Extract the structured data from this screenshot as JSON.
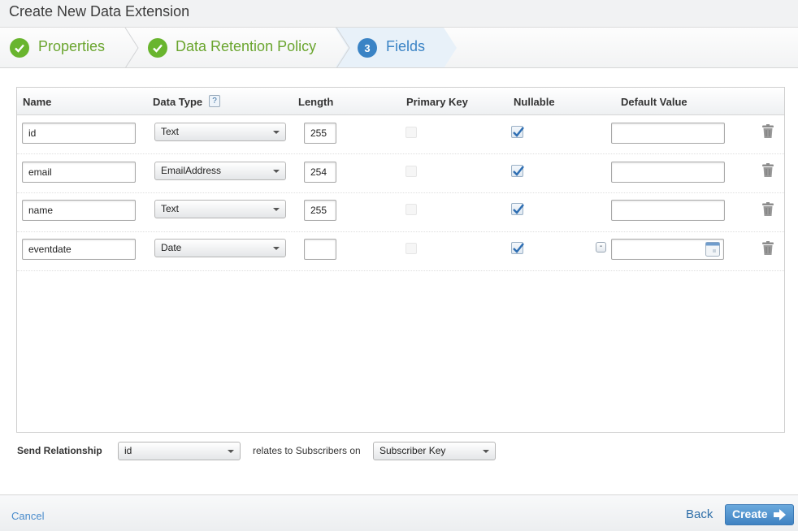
{
  "window": {
    "title": "Create New Data Extension"
  },
  "wizard": {
    "steps": [
      {
        "label": "Properties",
        "state": "complete",
        "icon": "check-circle-icon"
      },
      {
        "label": "Data Retention Policy",
        "state": "complete",
        "icon": "check-circle-icon"
      },
      {
        "number": "3",
        "label": "Fields",
        "state": "current"
      }
    ]
  },
  "grid": {
    "columns": [
      "Name",
      "Data Type",
      "Length",
      "Primary Key",
      "Nullable",
      "Default Value"
    ],
    "help_glyph": "?",
    "rows": [
      {
        "name": "id",
        "data_type": "Text",
        "length": "255",
        "primary_key": false,
        "nullable": true,
        "default_value": ""
      },
      {
        "name": "email",
        "data_type": "EmailAddress",
        "length": "254",
        "primary_key": false,
        "nullable": true,
        "default_value": ""
      },
      {
        "name": "name",
        "data_type": "Text",
        "length": "255",
        "primary_key": false,
        "nullable": true,
        "default_value": ""
      },
      {
        "name": "eventdate",
        "data_type": "Date",
        "length": "",
        "primary_key": false,
        "nullable": true,
        "default_value": "",
        "minus_glyph": "-"
      }
    ]
  },
  "send_relationship": {
    "label": "Send Relationship",
    "field_value": "id",
    "relates_text": "relates to Subscribers on",
    "subscriber_value": "Subscriber Key"
  },
  "footer": {
    "cancel": "Cancel",
    "back": "Back",
    "create": "Create"
  },
  "colors": {
    "accent_blue": "#3a83c5",
    "complete_green": "#69b52e",
    "create_button": "#4a8fcf"
  }
}
